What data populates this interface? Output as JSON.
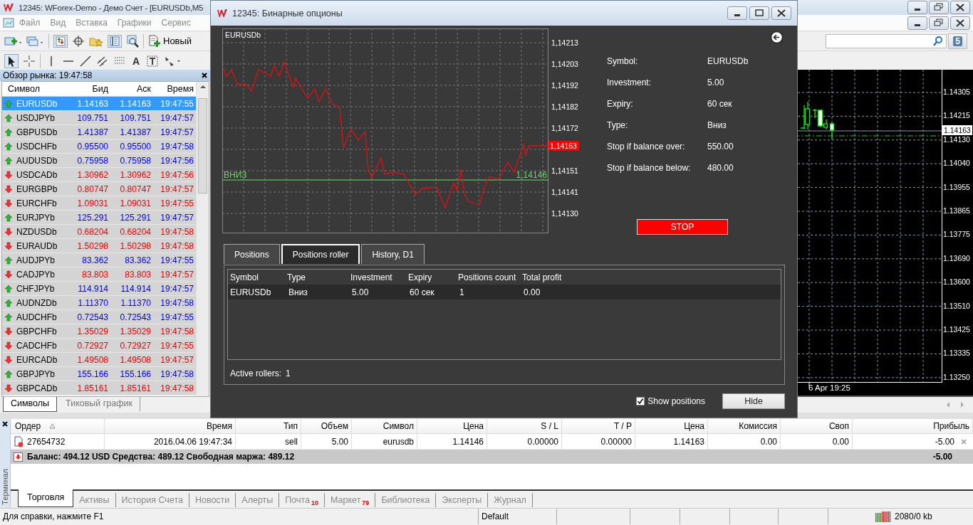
{
  "window": {
    "title": "12345: WForex-Demo - Демо Счет - [EURUSDb,M5"
  },
  "menu": [
    "Файл",
    "Вид",
    "Вставка",
    "Графики",
    "Сервис"
  ],
  "toolbar": {
    "new_order": "Новый",
    "text_tool": "A"
  },
  "market_watch": {
    "title": "Обзор рынка: 19:47:58",
    "columns": [
      "Символ",
      "Бид",
      "Аск",
      "Время"
    ],
    "rows": [
      {
        "symbol": "EURUSDb",
        "bid": "1.14163",
        "ask": "1.14163",
        "time": "19:47:55",
        "rising": true,
        "selected": true
      },
      {
        "symbol": "USDJPYb",
        "bid": "109.751",
        "ask": "109.751",
        "time": "19:47:57",
        "rising": true,
        "selected": false
      },
      {
        "symbol": "GBPUSDb",
        "bid": "1.41387",
        "ask": "1.41387",
        "time": "19:47:57",
        "rising": true,
        "selected": false
      },
      {
        "symbol": "USDCHFb",
        "bid": "0.95500",
        "ask": "0.95500",
        "time": "19:47:58",
        "rising": true,
        "selected": false
      },
      {
        "symbol": "AUDUSDb",
        "bid": "0.75958",
        "ask": "0.75958",
        "time": "19:47:56",
        "rising": true,
        "selected": false
      },
      {
        "symbol": "USDCADb",
        "bid": "1.30962",
        "ask": "1.30962",
        "time": "19:47:56",
        "rising": false,
        "selected": false
      },
      {
        "symbol": "EURGBPb",
        "bid": "0.80747",
        "ask": "0.80747",
        "time": "19:47:57",
        "rising": false,
        "selected": false
      },
      {
        "symbol": "EURCHFb",
        "bid": "1.09031",
        "ask": "1.09031",
        "time": "19:47:55",
        "rising": false,
        "selected": false
      },
      {
        "symbol": "EURJPYb",
        "bid": "125.291",
        "ask": "125.291",
        "time": "19:47:57",
        "rising": true,
        "selected": false
      },
      {
        "symbol": "NZDUSDb",
        "bid": "0.68204",
        "ask": "0.68204",
        "time": "19:47:58",
        "rising": false,
        "selected": false
      },
      {
        "symbol": "EURAUDb",
        "bid": "1.50298",
        "ask": "1.50298",
        "time": "19:47:58",
        "rising": false,
        "selected": false
      },
      {
        "symbol": "AUDJPYb",
        "bid": "83.362",
        "ask": "83.362",
        "time": "19:47:55",
        "rising": true,
        "selected": false
      },
      {
        "symbol": "CADJPYb",
        "bid": "83.803",
        "ask": "83.803",
        "time": "19:47:57",
        "rising": false,
        "selected": false
      },
      {
        "symbol": "CHFJPYb",
        "bid": "114.914",
        "ask": "114.914",
        "time": "19:47:57",
        "rising": true,
        "selected": false
      },
      {
        "symbol": "AUDNZDb",
        "bid": "1.11370",
        "ask": "1.11370",
        "time": "19:47:58",
        "rising": true,
        "selected": false
      },
      {
        "symbol": "AUDCHFb",
        "bid": "0.72543",
        "ask": "0.72543",
        "time": "19:47:55",
        "rising": true,
        "selected": false
      },
      {
        "symbol": "GBPCHFb",
        "bid": "1.35029",
        "ask": "1.35029",
        "time": "19:47:58",
        "rising": false,
        "selected": false
      },
      {
        "symbol": "CADCHFb",
        "bid": "0.72927",
        "ask": "0.72927",
        "time": "19:47:55",
        "rising": false,
        "selected": false
      },
      {
        "symbol": "EURCADb",
        "bid": "1.49508",
        "ask": "1.49508",
        "time": "19:47:57",
        "rising": false,
        "selected": false
      },
      {
        "symbol": "GBPJPYb",
        "bid": "155.166",
        "ask": "155.166",
        "time": "19:47:58",
        "rising": true,
        "selected": false
      },
      {
        "symbol": "GBPCADb",
        "bid": "1.85161",
        "ask": "1.85161",
        "time": "19:47:58",
        "rising": false,
        "selected": false
      }
    ],
    "tabs": [
      {
        "label": "Символы",
        "selected": true
      },
      {
        "label": "Тиковый график",
        "selected": false
      }
    ]
  },
  "chart_window": {
    "price_axis": [
      "1.14305",
      "1.14215",
      "1.14130",
      "1.14040",
      "1.13955",
      "1.13865",
      "1.13775",
      "1.13690",
      "1.13600",
      "1.13510",
      "1.13425",
      "1.13335",
      "1.13250"
    ],
    "current_price": "1.14163",
    "time_label": "6 Apr 19:25",
    "notification_count": "5"
  },
  "dialog": {
    "title": "12345: Бинарные опционы",
    "price_chart": {
      "title": "EURUSDb",
      "axis_labels": [
        "1,14213",
        "1,14203",
        "1,14192",
        "1,14182",
        "1,14172",
        "1,14151",
        "1,14141",
        "1,14130"
      ],
      "level_label": "ВНИЗ",
      "level_value": "1,14146",
      "current_price": "1,14163"
    },
    "info": [
      {
        "label": "Symbol:",
        "value": "EURUSDb"
      },
      {
        "label": "Investment:",
        "value": "5.00"
      },
      {
        "label": "Expiry:",
        "value": "60 сек"
      },
      {
        "label": "Type:",
        "value": "Вниз"
      },
      {
        "label": "Stop if balance over:",
        "value": "550.00"
      },
      {
        "label": "Stop if balance below:",
        "value": "480.00"
      }
    ],
    "stop_button": "STOP",
    "tabs": [
      {
        "label": "Positions",
        "selected": false
      },
      {
        "label": "Positions roller",
        "selected": true
      },
      {
        "label": "History, D1",
        "selected": false
      }
    ],
    "table": {
      "columns": [
        "Symbol",
        "Type",
        "Investment",
        "Expiry",
        "Positions count",
        "Total profit"
      ],
      "rows": [
        [
          "EURUSDb",
          "Вниз",
          "5.00",
          "60 сек",
          "1",
          "0.00"
        ]
      ]
    },
    "active_rollers": {
      "label": "Active rollers:",
      "value": "1"
    },
    "show_positions": {
      "label": "Show positions",
      "checked": true
    },
    "hide_button": "Hide"
  },
  "terminal": {
    "side_label": "Терминал",
    "columns": [
      "Ордер",
      "Время",
      "Тип",
      "Объем",
      "Символ",
      "Цена",
      "S / L",
      "T / P",
      "Цена",
      "Комиссия",
      "Своп",
      "Прибыль"
    ],
    "rows": [
      [
        "27654732",
        "2016.04.06 19:47:34",
        "sell",
        "5.00",
        "eurusdb",
        "1.14146",
        "0.00000",
        "0.00000",
        "1.14163",
        "0.00",
        "0.00",
        "-5.00"
      ]
    ],
    "summary": {
      "text": "Баланс: 494.12 USD  Средства: 489.12  Свободная маржа: 489.12",
      "total": "-5.00"
    },
    "tabs": [
      {
        "label": "Торговля",
        "selected": true
      },
      {
        "label": "Активы",
        "selected": false
      },
      {
        "label": "История Счета",
        "selected": false
      },
      {
        "label": "Новости",
        "selected": false
      },
      {
        "label": "Алерты",
        "selected": false
      },
      {
        "label": "Почта",
        "badge": "10",
        "selected": false
      },
      {
        "label": "Маркет",
        "badge": "79",
        "selected": false
      },
      {
        "label": "Библиотека",
        "selected": false
      },
      {
        "label": "Эксперты",
        "selected": false
      },
      {
        "label": "Журнал",
        "selected": false
      }
    ]
  },
  "status_bar": {
    "help": "Для справки, нажмите F1",
    "profile": "Default",
    "traffic": "2080/0 kb"
  }
}
